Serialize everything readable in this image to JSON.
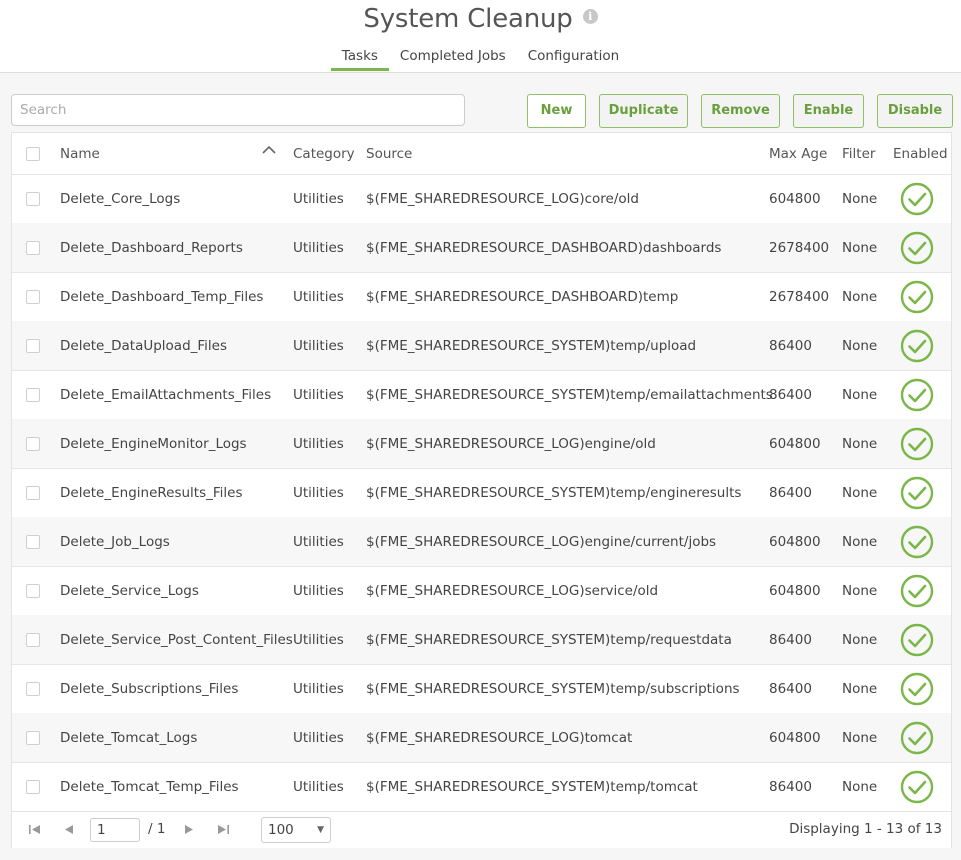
{
  "header": {
    "title": "System Cleanup",
    "info_icon": "i",
    "tabs": [
      {
        "label": "Tasks",
        "active": true
      },
      {
        "label": "Completed Jobs",
        "active": false
      },
      {
        "label": "Configuration",
        "active": false
      }
    ]
  },
  "toolbar": {
    "search_placeholder": "Search",
    "buttons": {
      "new": "New",
      "duplicate": "Duplicate",
      "remove": "Remove",
      "enable": "Enable",
      "disable": "Disable"
    }
  },
  "table": {
    "columns": {
      "name": "Name",
      "category": "Category",
      "source": "Source",
      "max_age": "Max Age",
      "filter": "Filter",
      "enabled": "Enabled"
    },
    "sort_icon": "chevron-up-icon",
    "enabled_icon": "check-circle-icon",
    "rows": [
      {
        "name": "Delete_Core_Logs",
        "category": "Utilities",
        "source": "$(FME_SHAREDRESOURCE_LOG)core/old",
        "max_age": "604800",
        "filter": "None"
      },
      {
        "name": "Delete_Dashboard_Reports",
        "category": "Utilities",
        "source": "$(FME_SHAREDRESOURCE_DASHBOARD)dashboards",
        "max_age": "2678400",
        "filter": "None"
      },
      {
        "name": "Delete_Dashboard_Temp_Files",
        "category": "Utilities",
        "source": "$(FME_SHAREDRESOURCE_DASHBOARD)temp",
        "max_age": "2678400",
        "filter": "None"
      },
      {
        "name": "Delete_DataUpload_Files",
        "category": "Utilities",
        "source": "$(FME_SHAREDRESOURCE_SYSTEM)temp/upload",
        "max_age": "86400",
        "filter": "None"
      },
      {
        "name": "Delete_EmailAttachments_Files",
        "category": "Utilities",
        "source": "$(FME_SHAREDRESOURCE_SYSTEM)temp/emailattachments",
        "max_age": "86400",
        "filter": "None"
      },
      {
        "name": "Delete_EngineMonitor_Logs",
        "category": "Utilities",
        "source": "$(FME_SHAREDRESOURCE_LOG)engine/old",
        "max_age": "604800",
        "filter": "None"
      },
      {
        "name": "Delete_EngineResults_Files",
        "category": "Utilities",
        "source": "$(FME_SHAREDRESOURCE_SYSTEM)temp/engineresults",
        "max_age": "86400",
        "filter": "None"
      },
      {
        "name": "Delete_Job_Logs",
        "category": "Utilities",
        "source": "$(FME_SHAREDRESOURCE_LOG)engine/current/jobs",
        "max_age": "604800",
        "filter": "None"
      },
      {
        "name": "Delete_Service_Logs",
        "category": "Utilities",
        "source": "$(FME_SHAREDRESOURCE_LOG)service/old",
        "max_age": "604800",
        "filter": "None"
      },
      {
        "name": "Delete_Service_Post_Content_Files",
        "category": "Utilities",
        "source": "$(FME_SHAREDRESOURCE_SYSTEM)temp/requestdata",
        "max_age": "86400",
        "filter": "None"
      },
      {
        "name": "Delete_Subscriptions_Files",
        "category": "Utilities",
        "source": "$(FME_SHAREDRESOURCE_SYSTEM)temp/subscriptions",
        "max_age": "86400",
        "filter": "None"
      },
      {
        "name": "Delete_Tomcat_Logs",
        "category": "Utilities",
        "source": "$(FME_SHAREDRESOURCE_LOG)tomcat",
        "max_age": "604800",
        "filter": "None"
      },
      {
        "name": "Delete_Tomcat_Temp_Files",
        "category": "Utilities",
        "source": "$(FME_SHAREDRESOURCE_SYSTEM)temp/tomcat",
        "max_age": "86400",
        "filter": "None"
      }
    ]
  },
  "pagination": {
    "page_value": "1",
    "page_total": "/ 1",
    "page_size": "100",
    "display_text": "Displaying 1 - 13 of 13"
  },
  "colors": {
    "accent": "#7ab648",
    "button_text": "#6a9f3d",
    "check": "#7ab648"
  }
}
